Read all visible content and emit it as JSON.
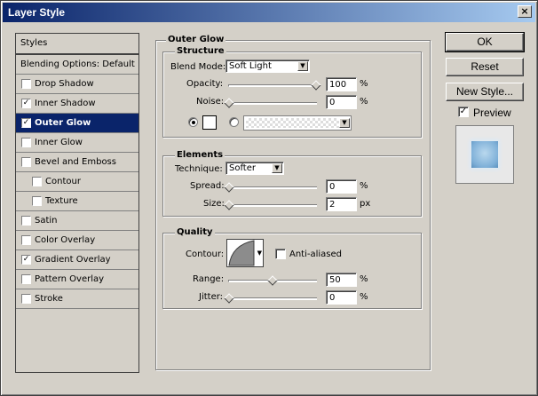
{
  "window": {
    "title": "Layer Style",
    "close_glyph": "×"
  },
  "styles_list": {
    "items": [
      {
        "label": "Styles",
        "checked": null,
        "indent": 0,
        "selected": false
      },
      {
        "label": "Blending Options: Default",
        "checked": null,
        "indent": 0,
        "selected": false
      },
      {
        "label": "Drop Shadow",
        "checked": false,
        "indent": 0,
        "selected": false
      },
      {
        "label": "Inner Shadow",
        "checked": true,
        "indent": 0,
        "selected": false
      },
      {
        "label": "Outer Glow",
        "checked": true,
        "indent": 0,
        "selected": true
      },
      {
        "label": "Inner Glow",
        "checked": false,
        "indent": 0,
        "selected": false
      },
      {
        "label": "Bevel and Emboss",
        "checked": false,
        "indent": 0,
        "selected": false
      },
      {
        "label": "Contour",
        "checked": false,
        "indent": 1,
        "selected": false
      },
      {
        "label": "Texture",
        "checked": false,
        "indent": 1,
        "selected": false
      },
      {
        "label": "Satin",
        "checked": false,
        "indent": 0,
        "selected": false
      },
      {
        "label": "Color Overlay",
        "checked": false,
        "indent": 0,
        "selected": false
      },
      {
        "label": "Gradient Overlay",
        "checked": true,
        "indent": 0,
        "selected": false
      },
      {
        "label": "Pattern Overlay",
        "checked": false,
        "indent": 0,
        "selected": false
      },
      {
        "label": "Stroke",
        "checked": false,
        "indent": 0,
        "selected": false
      }
    ]
  },
  "outer_glow": {
    "title": "Outer Glow",
    "structure": {
      "title": "Structure",
      "blend_mode_label": "Blend Mode:",
      "blend_mode_value": "Soft Light",
      "opacity_label": "Opacity:",
      "opacity_value": "100",
      "opacity_fraction": 1.0,
      "noise_label": "Noise:",
      "noise_value": "0",
      "noise_fraction": 0.0,
      "percent": "%"
    },
    "elements": {
      "title": "Elements",
      "technique_label": "Technique:",
      "technique_value": "Softer",
      "spread_label": "Spread:",
      "spread_value": "0",
      "spread_fraction": 0.0,
      "size_label": "Size:",
      "size_value": "2",
      "size_fraction": 0.0,
      "percent": "%",
      "px": "px"
    },
    "quality": {
      "title": "Quality",
      "contour_label": "Contour:",
      "anti_aliased_label": "Anti-aliased",
      "anti_aliased": false,
      "range_label": "Range:",
      "range_value": "50",
      "range_fraction": 0.5,
      "jitter_label": "Jitter:",
      "jitter_value": "0",
      "jitter_fraction": 0.0,
      "percent": "%"
    }
  },
  "buttons": {
    "ok": "OK",
    "reset": "Reset",
    "new_style": "New Style...",
    "preview": "Preview",
    "preview_checked": true
  },
  "colors": {
    "title_bar_start": "#0a246a",
    "title_bar_end": "#a6caf0",
    "selection": "#0a246a",
    "preview_swatch": "#7fb0d8"
  }
}
